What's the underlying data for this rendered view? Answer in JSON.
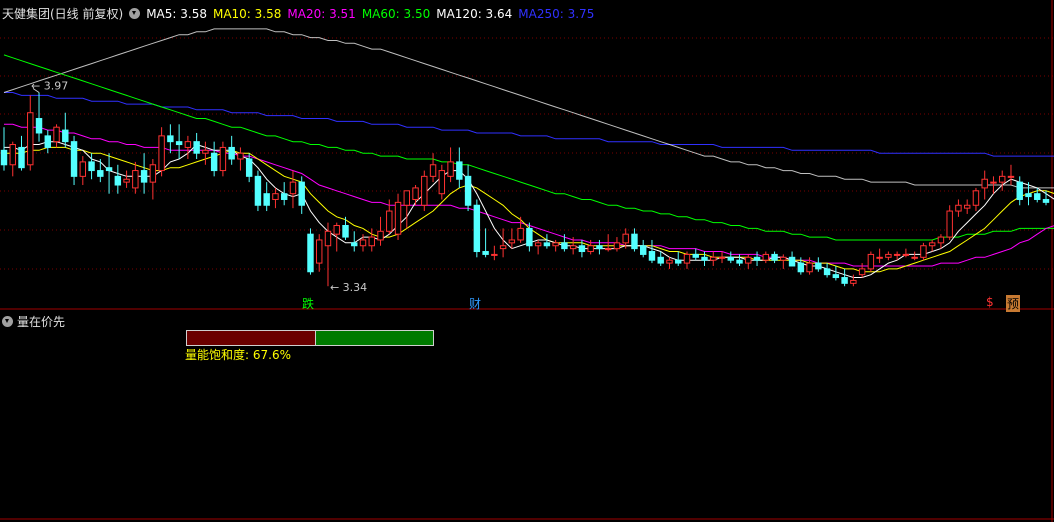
{
  "header": {
    "title": "天健集团(日线 前复权)",
    "ma": [
      {
        "label": "MA5: 3.58",
        "color": "#ffffff"
      },
      {
        "label": "MA10: 3.58",
        "color": "#ffff00"
      },
      {
        "label": "MA20: 3.51",
        "color": "#ff00ff"
      },
      {
        "label": "MA60: 3.50",
        "color": "#00ff00"
      },
      {
        "label": "MA120: 3.64",
        "color": "#ffffff"
      },
      {
        "label": "MA250: 3.75",
        "color": "#3030ff"
      }
    ]
  },
  "chart_data": {
    "type": "candlestick",
    "ylim": [
      3.28,
      4.2
    ],
    "annotations": {
      "high_label": "3.97",
      "low_label": "3.34",
      "event_1": "跌",
      "event_2": "财",
      "event_3": "$",
      "event_4": "预"
    },
    "candles": [
      [
        3.77,
        3.85,
        3.7,
        3.72
      ],
      [
        3.72,
        3.8,
        3.68,
        3.79
      ],
      [
        3.78,
        3.82,
        3.7,
        3.71
      ],
      [
        3.72,
        3.96,
        3.7,
        3.9
      ],
      [
        3.88,
        3.97,
        3.8,
        3.83
      ],
      [
        3.82,
        3.84,
        3.76,
        3.78
      ],
      [
        3.8,
        3.86,
        3.78,
        3.85
      ],
      [
        3.84,
        3.9,
        3.78,
        3.8
      ],
      [
        3.8,
        3.82,
        3.65,
        3.68
      ],
      [
        3.68,
        3.75,
        3.65,
        3.73
      ],
      [
        3.73,
        3.76,
        3.67,
        3.7
      ],
      [
        3.7,
        3.74,
        3.66,
        3.68
      ],
      [
        3.71,
        3.76,
        3.62,
        3.7
      ],
      [
        3.68,
        3.72,
        3.62,
        3.65
      ],
      [
        3.66,
        3.7,
        3.64,
        3.67
      ],
      [
        3.64,
        3.73,
        3.62,
        3.7
      ],
      [
        3.7,
        3.76,
        3.62,
        3.66
      ],
      [
        3.66,
        3.74,
        3.6,
        3.72
      ],
      [
        3.7,
        3.85,
        3.68,
        3.82
      ],
      [
        3.82,
        3.86,
        3.76,
        3.8
      ],
      [
        3.8,
        3.86,
        3.74,
        3.79
      ],
      [
        3.78,
        3.82,
        3.74,
        3.8
      ],
      [
        3.8,
        3.83,
        3.74,
        3.76
      ],
      [
        3.76,
        3.8,
        3.72,
        3.77
      ],
      [
        3.76,
        3.8,
        3.68,
        3.7
      ],
      [
        3.7,
        3.8,
        3.68,
        3.78
      ],
      [
        3.78,
        3.82,
        3.72,
        3.74
      ],
      [
        3.74,
        3.78,
        3.7,
        3.76
      ],
      [
        3.74,
        3.76,
        3.66,
        3.68
      ],
      [
        3.68,
        3.7,
        3.56,
        3.58
      ],
      [
        3.62,
        3.66,
        3.56,
        3.58
      ],
      [
        3.6,
        3.64,
        3.57,
        3.62
      ],
      [
        3.62,
        3.66,
        3.58,
        3.6
      ],
      [
        3.62,
        3.7,
        3.57,
        3.66
      ],
      [
        3.66,
        3.68,
        3.55,
        3.58
      ],
      [
        3.48,
        3.5,
        3.34,
        3.35
      ],
      [
        3.38,
        3.48,
        3.35,
        3.46
      ],
      [
        3.44,
        3.52,
        3.3,
        3.49
      ],
      [
        3.48,
        3.52,
        3.42,
        3.51
      ],
      [
        3.51,
        3.54,
        3.46,
        3.47
      ],
      [
        3.45,
        3.49,
        3.42,
        3.44
      ],
      [
        3.44,
        3.48,
        3.42,
        3.46
      ],
      [
        3.44,
        3.5,
        3.42,
        3.47
      ],
      [
        3.46,
        3.54,
        3.44,
        3.49
      ],
      [
        3.49,
        3.6,
        3.48,
        3.56
      ],
      [
        3.48,
        3.62,
        3.46,
        3.59
      ],
      [
        3.58,
        3.62,
        3.5,
        3.63
      ],
      [
        3.6,
        3.65,
        3.58,
        3.64
      ],
      [
        3.58,
        3.7,
        3.56,
        3.68
      ],
      [
        3.68,
        3.76,
        3.66,
        3.72
      ],
      [
        3.62,
        3.72,
        3.6,
        3.7
      ],
      [
        3.68,
        3.78,
        3.66,
        3.73
      ],
      [
        3.73,
        3.78,
        3.64,
        3.67
      ],
      [
        3.68,
        3.72,
        3.56,
        3.58
      ],
      [
        3.58,
        3.6,
        3.4,
        3.42
      ],
      [
        3.42,
        3.5,
        3.4,
        3.41
      ],
      [
        3.41,
        3.44,
        3.39,
        3.41
      ],
      [
        3.43,
        3.5,
        3.4,
        3.44
      ],
      [
        3.45,
        3.5,
        3.43,
        3.46
      ],
      [
        3.46,
        3.54,
        3.45,
        3.5
      ],
      [
        3.5,
        3.52,
        3.42,
        3.44
      ],
      [
        3.44,
        3.46,
        3.41,
        3.45
      ],
      [
        3.45,
        3.48,
        3.43,
        3.44
      ],
      [
        3.44,
        3.46,
        3.42,
        3.45
      ],
      [
        3.45,
        3.48,
        3.42,
        3.43
      ],
      [
        3.43,
        3.47,
        3.41,
        3.44
      ],
      [
        3.44,
        3.46,
        3.4,
        3.42
      ],
      [
        3.42,
        3.46,
        3.41,
        3.44
      ],
      [
        3.44,
        3.46,
        3.41,
        3.43
      ],
      [
        3.43,
        3.48,
        3.42,
        3.43
      ],
      [
        3.43,
        3.47,
        3.42,
        3.45
      ],
      [
        3.45,
        3.5,
        3.43,
        3.48
      ],
      [
        3.48,
        3.5,
        3.42,
        3.43
      ],
      [
        3.44,
        3.46,
        3.4,
        3.41
      ],
      [
        3.42,
        3.46,
        3.38,
        3.39
      ],
      [
        3.4,
        3.42,
        3.37,
        3.38
      ],
      [
        3.38,
        3.4,
        3.36,
        3.39
      ],
      [
        3.39,
        3.42,
        3.37,
        3.38
      ],
      [
        3.38,
        3.42,
        3.36,
        3.41
      ],
      [
        3.41,
        3.43,
        3.39,
        3.4
      ],
      [
        3.4,
        3.42,
        3.37,
        3.39
      ],
      [
        3.39,
        3.42,
        3.37,
        3.4
      ],
      [
        3.4,
        3.42,
        3.38,
        3.4
      ],
      [
        3.4,
        3.42,
        3.38,
        3.39
      ],
      [
        3.39,
        3.41,
        3.37,
        3.38
      ],
      [
        3.38,
        3.41,
        3.36,
        3.4
      ],
      [
        3.4,
        3.42,
        3.37,
        3.39
      ],
      [
        3.39,
        3.42,
        3.38,
        3.41
      ],
      [
        3.41,
        3.42,
        3.38,
        3.39
      ],
      [
        3.39,
        3.41,
        3.36,
        3.4
      ],
      [
        3.4,
        3.42,
        3.37,
        3.37
      ],
      [
        3.38,
        3.4,
        3.34,
        3.35
      ],
      [
        3.35,
        3.4,
        3.34,
        3.38
      ],
      [
        3.38,
        3.4,
        3.35,
        3.36
      ],
      [
        3.36,
        3.38,
        3.33,
        3.34
      ],
      [
        3.34,
        3.37,
        3.32,
        3.33
      ],
      [
        3.33,
        3.36,
        3.3,
        3.31
      ],
      [
        3.31,
        3.34,
        3.3,
        3.32
      ],
      [
        3.34,
        3.38,
        3.33,
        3.36
      ],
      [
        3.36,
        3.42,
        3.35,
        3.41
      ],
      [
        3.4,
        3.43,
        3.38,
        3.4
      ],
      [
        3.4,
        3.42,
        3.39,
        3.41
      ],
      [
        3.41,
        3.42,
        3.39,
        3.41
      ],
      [
        3.41,
        3.43,
        3.4,
        3.41
      ],
      [
        3.4,
        3.42,
        3.39,
        3.4
      ],
      [
        3.4,
        3.45,
        3.39,
        3.44
      ],
      [
        3.44,
        3.46,
        3.42,
        3.45
      ],
      [
        3.45,
        3.48,
        3.43,
        3.47
      ],
      [
        3.47,
        3.58,
        3.46,
        3.56
      ],
      [
        3.56,
        3.6,
        3.54,
        3.58
      ],
      [
        3.57,
        3.6,
        3.55,
        3.58
      ],
      [
        3.58,
        3.64,
        3.56,
        3.63
      ],
      [
        3.64,
        3.7,
        3.6,
        3.67
      ],
      [
        3.66,
        3.68,
        3.62,
        3.66
      ],
      [
        3.66,
        3.7,
        3.63,
        3.68
      ],
      [
        3.68,
        3.72,
        3.65,
        3.68
      ],
      [
        3.66,
        3.68,
        3.58,
        3.6
      ],
      [
        3.62,
        3.66,
        3.58,
        3.61
      ],
      [
        3.62,
        3.64,
        3.59,
        3.6
      ],
      [
        3.6,
        3.63,
        3.58,
        3.59
      ]
    ],
    "ma5": [
      3.78,
      3.78,
      3.77,
      3.79,
      3.79,
      3.8,
      3.8,
      3.79,
      3.78,
      3.77,
      3.74,
      3.73,
      3.7,
      3.69,
      3.68,
      3.68,
      3.68,
      3.68,
      3.7,
      3.73,
      3.74,
      3.76,
      3.79,
      3.78,
      3.77,
      3.77,
      3.77,
      3.75,
      3.74,
      3.71,
      3.67,
      3.64,
      3.62,
      3.61,
      3.62,
      3.56,
      3.52,
      3.49,
      3.47,
      3.45,
      3.45,
      3.47,
      3.47,
      3.46,
      3.48,
      3.51,
      3.54,
      3.59,
      3.62,
      3.65,
      3.68,
      3.7,
      3.7,
      3.67,
      3.62,
      3.56,
      3.5,
      3.46,
      3.43,
      3.44,
      3.45,
      3.46,
      3.46,
      3.45,
      3.44,
      3.44,
      3.43,
      3.43,
      3.43,
      3.43,
      3.43,
      3.44,
      3.44,
      3.44,
      3.43,
      3.42,
      3.4,
      3.39,
      3.39,
      3.39,
      3.39,
      3.39,
      3.4,
      3.4,
      3.4,
      3.39,
      3.39,
      3.39,
      3.4,
      3.4,
      3.39,
      3.38,
      3.37,
      3.37,
      3.36,
      3.35,
      3.34,
      3.33,
      3.33,
      3.34,
      3.36,
      3.38,
      3.39,
      3.41,
      3.41,
      3.41,
      3.42,
      3.43,
      3.45,
      3.49,
      3.52,
      3.55,
      3.58,
      3.62,
      3.65,
      3.67,
      3.66,
      3.65,
      3.64,
      3.62,
      3.6
    ],
    "ma10": [
      3.76,
      3.76,
      3.76,
      3.77,
      3.77,
      3.78,
      3.78,
      3.78,
      3.77,
      3.77,
      3.76,
      3.76,
      3.75,
      3.74,
      3.73,
      3.72,
      3.71,
      3.7,
      3.7,
      3.71,
      3.71,
      3.72,
      3.73,
      3.74,
      3.75,
      3.76,
      3.77,
      3.76,
      3.76,
      3.74,
      3.72,
      3.7,
      3.68,
      3.67,
      3.66,
      3.62,
      3.59,
      3.56,
      3.54,
      3.53,
      3.51,
      3.5,
      3.48,
      3.47,
      3.47,
      3.48,
      3.5,
      3.52,
      3.54,
      3.56,
      3.59,
      3.62,
      3.64,
      3.65,
      3.64,
      3.62,
      3.6,
      3.58,
      3.55,
      3.53,
      3.5,
      3.48,
      3.46,
      3.45,
      3.45,
      3.45,
      3.45,
      3.44,
      3.44,
      3.44,
      3.44,
      3.44,
      3.44,
      3.44,
      3.44,
      3.43,
      3.42,
      3.42,
      3.41,
      3.41,
      3.41,
      3.4,
      3.4,
      3.4,
      3.4,
      3.4,
      3.39,
      3.39,
      3.39,
      3.39,
      3.39,
      3.39,
      3.38,
      3.38,
      3.38,
      3.37,
      3.36,
      3.36,
      3.35,
      3.35,
      3.35,
      3.36,
      3.36,
      3.37,
      3.38,
      3.39,
      3.4,
      3.41,
      3.42,
      3.44,
      3.46,
      3.48,
      3.5,
      3.53,
      3.56,
      3.59,
      3.61,
      3.62,
      3.63,
      3.63,
      3.62
    ],
    "ma20": [
      3.86,
      3.86,
      3.85,
      3.85,
      3.85,
      3.84,
      3.84,
      3.83,
      3.83,
      3.82,
      3.81,
      3.81,
      3.8,
      3.8,
      3.79,
      3.79,
      3.78,
      3.78,
      3.78,
      3.77,
      3.77,
      3.77,
      3.77,
      3.77,
      3.77,
      3.76,
      3.76,
      3.75,
      3.75,
      3.74,
      3.73,
      3.72,
      3.71,
      3.7,
      3.69,
      3.67,
      3.65,
      3.64,
      3.63,
      3.62,
      3.61,
      3.6,
      3.59,
      3.59,
      3.58,
      3.58,
      3.58,
      3.58,
      3.58,
      3.58,
      3.58,
      3.58,
      3.57,
      3.57,
      3.56,
      3.55,
      3.54,
      3.53,
      3.52,
      3.52,
      3.51,
      3.5,
      3.49,
      3.48,
      3.47,
      3.46,
      3.46,
      3.45,
      3.45,
      3.45,
      3.45,
      3.44,
      3.44,
      3.44,
      3.44,
      3.44,
      3.43,
      3.43,
      3.43,
      3.43,
      3.42,
      3.42,
      3.42,
      3.41,
      3.41,
      3.41,
      3.41,
      3.4,
      3.4,
      3.4,
      3.39,
      3.39,
      3.39,
      3.38,
      3.38,
      3.38,
      3.38,
      3.37,
      3.37,
      3.37,
      3.37,
      3.37,
      3.37,
      3.37,
      3.37,
      3.37,
      3.37,
      3.38,
      3.38,
      3.38,
      3.39,
      3.4,
      3.4,
      3.41,
      3.42,
      3.43,
      3.45,
      3.46,
      3.48,
      3.5,
      3.51
    ],
    "ma60": [
      4.1,
      4.09,
      4.08,
      4.07,
      4.06,
      4.05,
      4.04,
      4.03,
      4.02,
      4.01,
      4.0,
      3.99,
      3.98,
      3.97,
      3.96,
      3.95,
      3.94,
      3.93,
      3.92,
      3.91,
      3.9,
      3.89,
      3.88,
      3.88,
      3.87,
      3.86,
      3.85,
      3.85,
      3.84,
      3.83,
      3.82,
      3.82,
      3.81,
      3.8,
      3.8,
      3.79,
      3.79,
      3.78,
      3.78,
      3.77,
      3.77,
      3.76,
      3.76,
      3.75,
      3.75,
      3.75,
      3.74,
      3.74,
      3.74,
      3.74,
      3.73,
      3.73,
      3.72,
      3.72,
      3.71,
      3.7,
      3.69,
      3.68,
      3.67,
      3.66,
      3.65,
      3.64,
      3.63,
      3.62,
      3.62,
      3.61,
      3.6,
      3.6,
      3.59,
      3.58,
      3.58,
      3.57,
      3.57,
      3.56,
      3.56,
      3.55,
      3.55,
      3.54,
      3.54,
      3.53,
      3.53,
      3.52,
      3.52,
      3.51,
      3.51,
      3.5,
      3.5,
      3.49,
      3.49,
      3.49,
      3.48,
      3.48,
      3.47,
      3.47,
      3.47,
      3.46,
      3.46,
      3.46,
      3.46,
      3.46,
      3.46,
      3.46,
      3.46,
      3.46,
      3.46,
      3.46,
      3.46,
      3.47,
      3.47,
      3.47,
      3.48,
      3.48,
      3.48,
      3.49,
      3.49,
      3.49,
      3.5,
      3.5,
      3.5,
      3.5,
      3.5
    ],
    "ma120": [
      3.97,
      3.98,
      3.99,
      4.0,
      4.01,
      4.02,
      4.03,
      4.04,
      4.05,
      4.06,
      4.07,
      4.08,
      4.09,
      4.1,
      4.11,
      4.12,
      4.13,
      4.14,
      4.15,
      4.16,
      4.17,
      4.17,
      4.18,
      4.18,
      4.19,
      4.19,
      4.19,
      4.19,
      4.19,
      4.19,
      4.19,
      4.18,
      4.18,
      4.17,
      4.17,
      4.16,
      4.16,
      4.15,
      4.15,
      4.14,
      4.14,
      4.13,
      4.12,
      4.12,
      4.11,
      4.1,
      4.09,
      4.08,
      4.07,
      4.06,
      4.05,
      4.04,
      4.03,
      4.02,
      4.01,
      4.0,
      3.99,
      3.98,
      3.97,
      3.96,
      3.95,
      3.94,
      3.93,
      3.92,
      3.91,
      3.9,
      3.89,
      3.88,
      3.87,
      3.86,
      3.85,
      3.84,
      3.83,
      3.82,
      3.81,
      3.8,
      3.79,
      3.78,
      3.77,
      3.76,
      3.75,
      3.75,
      3.74,
      3.73,
      3.73,
      3.72,
      3.72,
      3.71,
      3.71,
      3.7,
      3.7,
      3.69,
      3.69,
      3.68,
      3.68,
      3.68,
      3.67,
      3.67,
      3.67,
      3.66,
      3.66,
      3.66,
      3.66,
      3.66,
      3.65,
      3.65,
      3.65,
      3.65,
      3.65,
      3.65,
      3.65,
      3.65,
      3.65,
      3.65,
      3.65,
      3.65,
      3.64,
      3.64,
      3.64,
      3.64,
      3.64
    ],
    "ma250": [
      3.97,
      3.97,
      3.96,
      3.96,
      3.96,
      3.96,
      3.95,
      3.95,
      3.95,
      3.95,
      3.94,
      3.94,
      3.94,
      3.94,
      3.93,
      3.93,
      3.93,
      3.93,
      3.92,
      3.92,
      3.92,
      3.92,
      3.91,
      3.91,
      3.91,
      3.91,
      3.9,
      3.9,
      3.9,
      3.9,
      3.89,
      3.89,
      3.89,
      3.89,
      3.88,
      3.88,
      3.88,
      3.88,
      3.87,
      3.87,
      3.87,
      3.87,
      3.86,
      3.86,
      3.86,
      3.86,
      3.85,
      3.85,
      3.85,
      3.85,
      3.84,
      3.84,
      3.84,
      3.84,
      3.83,
      3.83,
      3.83,
      3.83,
      3.83,
      3.82,
      3.82,
      3.82,
      3.82,
      3.81,
      3.81,
      3.81,
      3.81,
      3.81,
      3.81,
      3.8,
      3.8,
      3.8,
      3.8,
      3.8,
      3.8,
      3.79,
      3.79,
      3.79,
      3.79,
      3.79,
      3.79,
      3.79,
      3.78,
      3.78,
      3.78,
      3.78,
      3.78,
      3.78,
      3.78,
      3.78,
      3.77,
      3.77,
      3.77,
      3.77,
      3.77,
      3.77,
      3.77,
      3.77,
      3.77,
      3.77,
      3.76,
      3.76,
      3.76,
      3.76,
      3.76,
      3.76,
      3.76,
      3.76,
      3.76,
      3.76,
      3.76,
      3.76,
      3.76,
      3.75,
      3.75,
      3.75,
      3.75,
      3.75,
      3.75,
      3.75,
      3.75
    ],
    "colors": {
      "up": "#ff3232",
      "down": "#54ffff",
      "ma5": "#ffffff",
      "ma10": "#ffff00",
      "ma20": "#ff00ff",
      "ma60": "#00ff00",
      "ma120": "#ffffff",
      "ma250": "#3030ff"
    }
  },
  "indicator": {
    "title": "量在价先",
    "saturation_label": "量能饱和度: 67.6%",
    "saturation": 0.522
  }
}
